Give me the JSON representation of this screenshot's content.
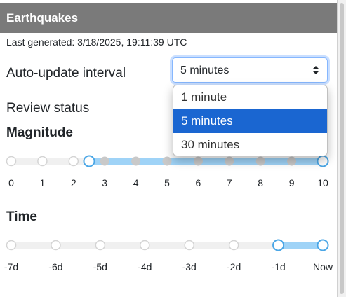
{
  "header": {
    "title": "Earthquakes"
  },
  "last_generated": "Last generated: 3/18/2025, 19:11:39 UTC",
  "auto_update": {
    "label": "Auto-update interval",
    "selected": "5 minutes",
    "options": [
      "1 minute",
      "5 minutes",
      "30 minutes"
    ]
  },
  "review_status": {
    "label": "Review status"
  },
  "magnitude": {
    "title": "Magnitude",
    "ticks": [
      "0",
      "1",
      "2",
      "3",
      "4",
      "5",
      "6",
      "7",
      "8",
      "9",
      "10"
    ],
    "range": [
      2.5,
      10
    ]
  },
  "time": {
    "title": "Time",
    "ticks": [
      "-7d",
      "-6d",
      "-5d",
      "-4d",
      "-3d",
      "-2d",
      "-1d",
      "Now"
    ],
    "range": [
      -1,
      0
    ]
  },
  "colors": {
    "header_bg": "#7a7a7a",
    "selected_option": "#1a66d1",
    "track_active": "#9fd3f7",
    "track_inactive": "#f0f0f0",
    "handle_border": "#4aa6e6"
  }
}
